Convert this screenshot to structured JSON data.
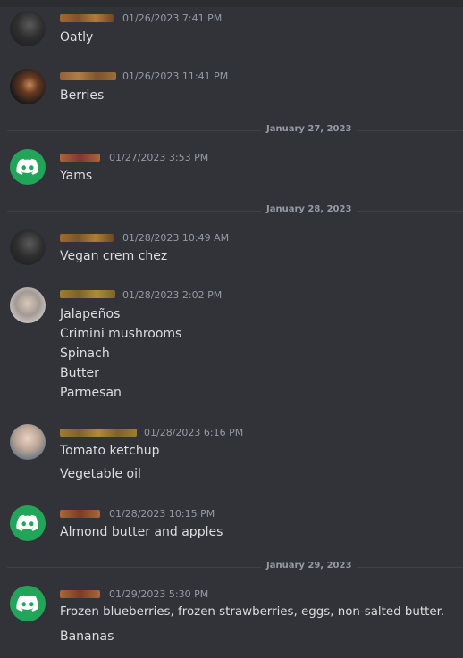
{
  "colors": {
    "background": "#313338",
    "text": "#dbdee1",
    "muted": "#949ba4",
    "discord_green": "#23a559",
    "divider": "#3f4147",
    "username_orange": "#c2703a",
    "username_gold": "#b38a2e"
  },
  "messages": [
    {
      "avatar": "dark-avatar",
      "timestamp": "01/26/2023 7:41 PM",
      "lines": [
        "Oatly"
      ]
    },
    {
      "avatar": "photo-avatar",
      "timestamp": "01/26/2023 11:41 PM",
      "lines": [
        "Berries"
      ]
    },
    {
      "avatar": "discord-icon",
      "timestamp": "01/27/2023 3:53 PM",
      "lines": [
        "Yams"
      ]
    },
    {
      "avatar": "dark-avatar",
      "timestamp": "01/28/2023 10:49 AM",
      "lines": [
        "Vegan crem chez"
      ]
    },
    {
      "avatar": "photo-avatar",
      "timestamp": "01/28/2023 2:02 PM",
      "lines": [
        "Jalapeños",
        "Crimini mushrooms",
        "Spinach",
        "Butter",
        "Parmesan"
      ]
    },
    {
      "avatar": "photo-avatar",
      "timestamp": "01/28/2023 6:16 PM",
      "lines": [
        "Tomato ketchup",
        "Vegetable oil"
      ]
    },
    {
      "avatar": "discord-icon",
      "timestamp": "01/28/2023 10:15 PM",
      "lines": [
        "Almond butter and apples"
      ]
    },
    {
      "avatar": "discord-icon",
      "timestamp": "01/29/2023 5:30 PM",
      "lines": [
        "Frozen blueberries, frozen strawberries, eggs, non-salted butter.",
        "Bananas"
      ]
    }
  ],
  "dividers": [
    "January 27, 2023",
    "January 28, 2023",
    "January 29, 2023"
  ]
}
